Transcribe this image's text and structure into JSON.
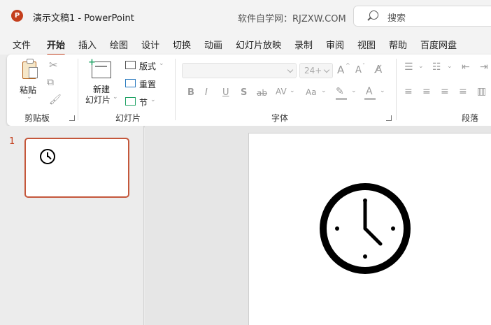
{
  "window": {
    "title": "演示文稿1  -  PowerPoint",
    "logo_letter": "P",
    "site_text": "软件自学网：RJZXW.COM",
    "search_placeholder": "搜索"
  },
  "menu_tabs": [
    {
      "label": "文件"
    },
    {
      "label": "开始",
      "active": true
    },
    {
      "label": "插入"
    },
    {
      "label": "绘图"
    },
    {
      "label": "设计"
    },
    {
      "label": "切换"
    },
    {
      "label": "动画"
    },
    {
      "label": "幻灯片放映"
    },
    {
      "label": "录制"
    },
    {
      "label": "审阅"
    },
    {
      "label": "视图"
    },
    {
      "label": "帮助"
    },
    {
      "label": "百度网盘"
    }
  ],
  "ribbon": {
    "clipboard": {
      "label": "剪贴板",
      "paste": "粘贴"
    },
    "slides": {
      "label": "幻灯片",
      "new_slide_line1": "新建",
      "new_slide_line2": "幻灯片",
      "layout": "版式",
      "reset": "重置",
      "section": "节"
    },
    "font": {
      "label": "字体",
      "font_name": "",
      "font_size": "24+",
      "bold": "B",
      "italic": "I",
      "underline": "U",
      "shadow": "S",
      "strikethrough": "ab",
      "spacing": "AV",
      "change_case": "Aa",
      "grow": "A",
      "shrink": "A",
      "font_color": "A"
    },
    "paragraph": {
      "label": "段落"
    }
  },
  "slides_pane": {
    "slide_number": "1"
  },
  "colors": {
    "accent": "#c43e1c",
    "thumb_border": "#c4573b"
  }
}
